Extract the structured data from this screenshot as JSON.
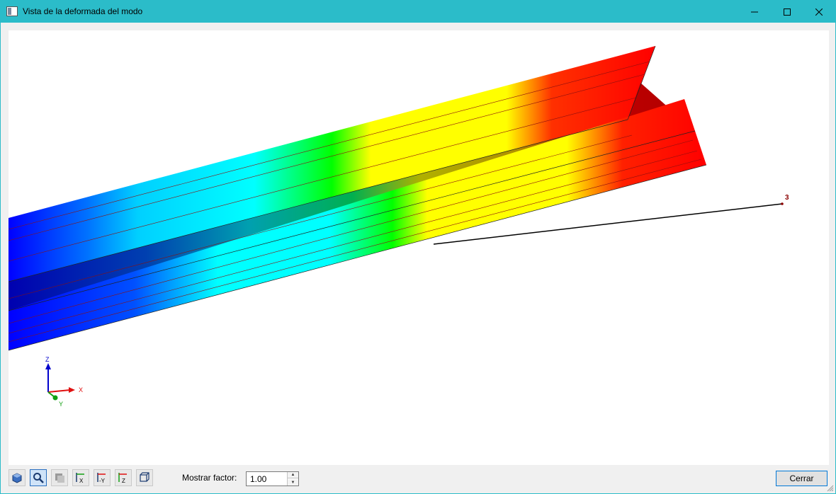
{
  "window": {
    "title": "Vista de la deformada del modo",
    "title_bar_color": "#2bbcc9",
    "controls": [
      "minimize-icon",
      "maximize-icon",
      "close-icon"
    ]
  },
  "viewport": {
    "background": "#ffffff",
    "node_label": "3",
    "axes": {
      "z_label": "Z",
      "x_label": "X",
      "y_label": "Y",
      "z_color": "#0000cc",
      "x_color": "#e01010",
      "y_color": "#12a012"
    },
    "color_scale": [
      "#0000ff",
      "#0060ff",
      "#00ffff",
      "#00ff00",
      "#ffff00",
      "#ff0000"
    ]
  },
  "toolbar": {
    "tools": [
      {
        "name": "render-icon",
        "active": false
      },
      {
        "name": "zoom-icon",
        "active": true
      },
      {
        "name": "pan-icon",
        "active": false
      },
      {
        "name": "view-x-icon",
        "label": "X",
        "active": false
      },
      {
        "name": "view-minus-y-icon",
        "label": "-Y",
        "active": false
      },
      {
        "name": "view-z-icon",
        "label": "Z",
        "active": false
      },
      {
        "name": "view-3d-icon",
        "active": false
      }
    ],
    "factor_label": "Mostrar factor:",
    "factor_value": "1.00"
  },
  "footer": {
    "close_label": "Cerrar"
  }
}
